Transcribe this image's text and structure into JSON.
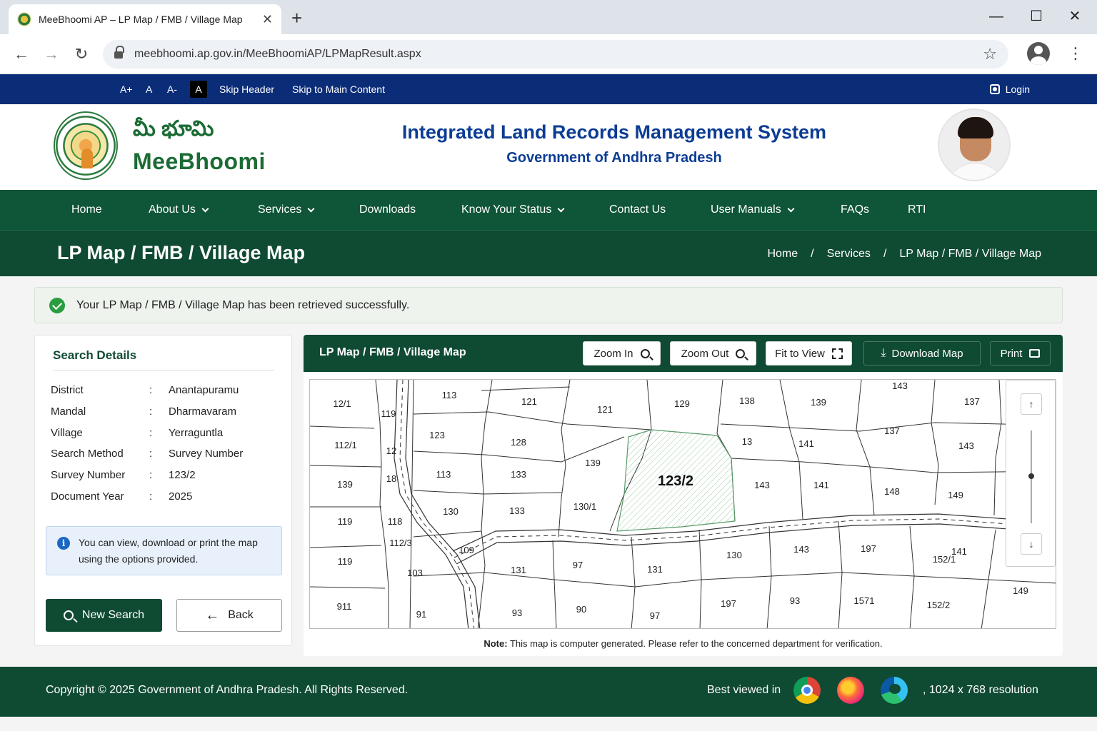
{
  "browser": {
    "tab_title": "MeeBhoomi AP – LP Map / FMB / Village Map",
    "tab_close": "✕",
    "new_tab": "+",
    "url": "meebhoomi.ap.gov.in/MeeBhoomiAP/LPMapResult.aspx",
    "window_controls": {
      "minimize": "—",
      "maximize": "☐",
      "close": "✕"
    },
    "nav": {
      "back": "←",
      "forward": "→",
      "reload": "↻",
      "star": "☆",
      "menu": "⋮"
    }
  },
  "accessibility_bar": {
    "font_increase": "A+",
    "font_normal": "A",
    "font_decrease": "A-",
    "dark_mode": "A",
    "skip_header": "Skip Header",
    "skip_main": "Skip to Main Content",
    "login": "Login"
  },
  "header": {
    "telugu_name": "మీ భూమి",
    "brand_name": "MeeBhoomi",
    "title": "Integrated Land Records Management System",
    "subtitle": "Government of Andhra Pradesh"
  },
  "nav": {
    "items": [
      {
        "label": "Home",
        "dropdown": false
      },
      {
        "label": "About Us",
        "dropdown": true
      },
      {
        "label": "Services",
        "dropdown": true
      },
      {
        "label": "Downloads",
        "dropdown": false
      },
      {
        "label": "Know Your Status",
        "dropdown": true
      },
      {
        "label": "Contact Us",
        "dropdown": false
      },
      {
        "label": "User Manuals",
        "dropdown": true
      },
      {
        "label": "FAQs",
        "dropdown": false
      },
      {
        "label": "RTI",
        "dropdown": false
      }
    ]
  },
  "page": {
    "title": "LP Map / FMB / Village Map",
    "breadcrumb": [
      "Home",
      "/",
      "Services",
      "/",
      "LP Map / FMB / Village Map"
    ]
  },
  "alert": {
    "message": "Your LP Map / FMB / Village Map has been retrieved successfully."
  },
  "search_details": {
    "title": "Search Details",
    "separator": ":",
    "rows": [
      {
        "label": "District",
        "value": "Anantapuramu"
      },
      {
        "label": "Mandal",
        "value": "Dharmavaram"
      },
      {
        "label": "Village",
        "value": "Yerraguntla"
      },
      {
        "label": "Search Method",
        "value": "Survey Number"
      },
      {
        "label": "Survey Number",
        "value": "123/2"
      },
      {
        "label": "Document Year",
        "value": "2025"
      }
    ],
    "info_icon": "i",
    "info": "You can view, download or print the map using the options provided.",
    "new_search": "New Search",
    "back": "Back",
    "back_arrow": "←"
  },
  "map": {
    "title": "LP Map / FMB / Village Map",
    "zoom_in": "Zoom In",
    "zoom_out": "Zoom Out",
    "fit_to_view": "Fit to View",
    "download": "Download Map",
    "download_icon": "⤓",
    "print": "Print",
    "zoom_up": "↑",
    "zoom_down": "↓",
    "highlighted_parcel": "123/2",
    "parcel_labels": [
      "12/1",
      "119",
      "113",
      "121",
      "121",
      "129",
      "138",
      "139",
      "143",
      "137",
      "112/1",
      "12",
      "123",
      "128",
      "13",
      "141",
      "137",
      "143",
      "139",
      "113",
      "18",
      "133",
      "139",
      "143",
      "141",
      "148",
      "149",
      "119",
      "118",
      "130",
      "133",
      "130/1",
      "112/3",
      "109",
      "131",
      "97",
      "131",
      "130",
      "143",
      "197",
      "152/1",
      "141",
      "119",
      "103",
      "91",
      "149",
      "911",
      "93",
      "90",
      "97",
      "197",
      "93",
      "1571",
      "152/2"
    ],
    "note_label": "Note:",
    "note_text": "This map is computer generated. Please refer to the concerned department for verification."
  },
  "footer": {
    "copyright": "Copyright © 2025 Government of Andhra Pradesh. All Rights Reserved.",
    "best_viewed": "Best viewed in",
    "resolution": ", 1024 x 768 resolution"
  }
}
